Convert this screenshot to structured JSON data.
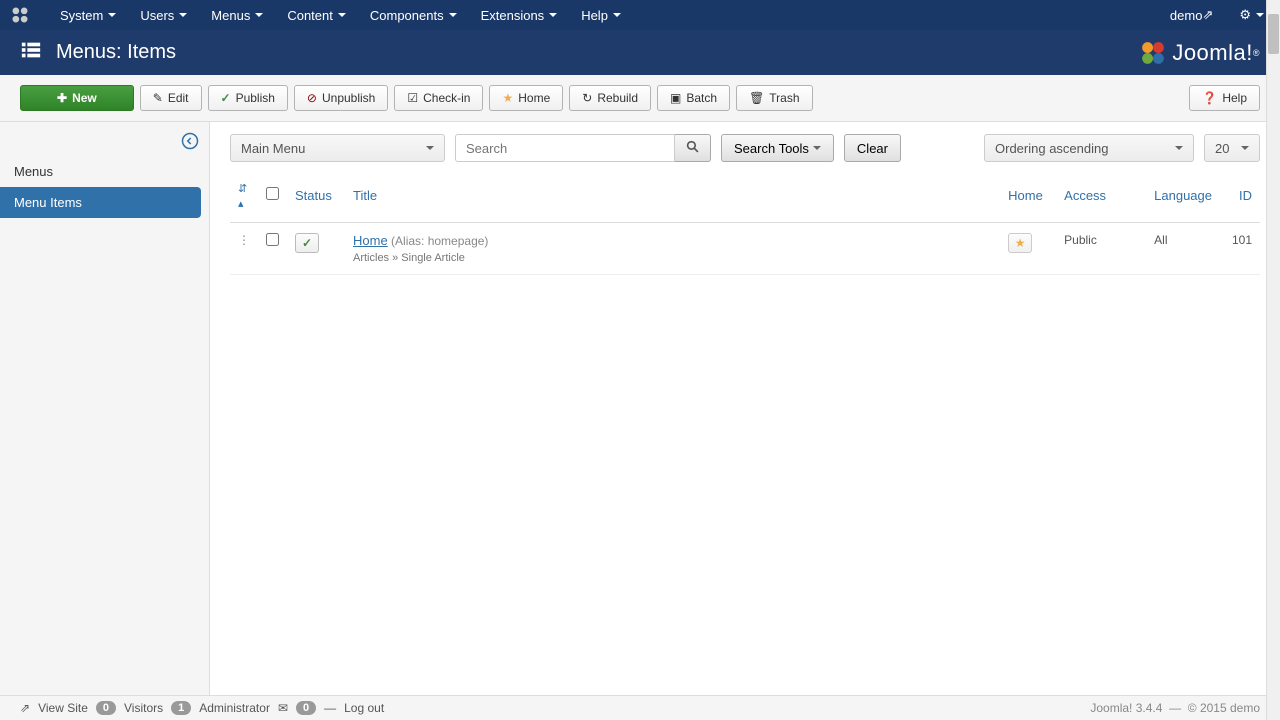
{
  "nav": {
    "items": [
      "System",
      "Users",
      "Menus",
      "Content",
      "Components",
      "Extensions",
      "Help"
    ],
    "user": "demo"
  },
  "header": {
    "title": "Menus: Items",
    "brand": "Joomla!"
  },
  "toolbar": {
    "new": "New",
    "edit": "Edit",
    "publish": "Publish",
    "unpublish": "Unpublish",
    "checkin": "Check-in",
    "home": "Home",
    "rebuild": "Rebuild",
    "batch": "Batch",
    "trash": "Trash",
    "help": "Help"
  },
  "sidebar": {
    "items": [
      {
        "label": "Menus"
      },
      {
        "label": "Menu Items"
      }
    ],
    "active": 1
  },
  "filters": {
    "menu_select": "Main Menu",
    "search_placeholder": "Search",
    "tools": "Search Tools",
    "clear": "Clear",
    "order": "Ordering ascending",
    "limit": "20"
  },
  "columns": {
    "status": "Status",
    "title": "Title",
    "home": "Home",
    "access": "Access",
    "language": "Language",
    "id": "ID"
  },
  "rows": [
    {
      "title": "Home",
      "alias": "(Alias: homepage)",
      "path": "Articles » Single Article",
      "home": true,
      "access": "Public",
      "language": "All",
      "id": "101"
    }
  ],
  "footer": {
    "view_site": "View Site",
    "visitors_count": "0",
    "visitors": "Visitors",
    "admins_count": "1",
    "admins": "Administrator",
    "msgs_count": "0",
    "logout": "Log out",
    "version": "Joomla! 3.4.4",
    "copyright": "© 2015 demo"
  }
}
